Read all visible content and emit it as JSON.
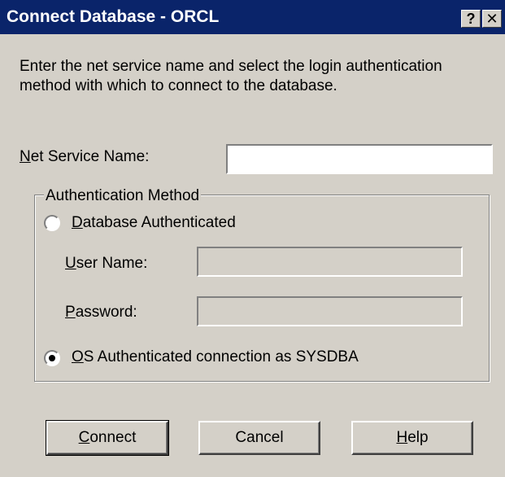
{
  "window": {
    "title": "Connect Database - ORCL",
    "help_button": "?",
    "close_button": "✕"
  },
  "intro_text": "Enter the net service name and select the login authentication method with which to connect to the database.",
  "net_service": {
    "label_mnemonic": "N",
    "label_rest": "et Service Name:",
    "value": ""
  },
  "auth": {
    "group_label": "Authentication Method",
    "database_option": {
      "mnemonic": "D",
      "rest": "atabase Authenticated",
      "selected": false
    },
    "user_name": {
      "mnemonic": "U",
      "rest": "ser Name:",
      "value": ""
    },
    "password": {
      "mnemonic": "P",
      "rest": "assword:",
      "value": ""
    },
    "os_option": {
      "mnemonic": "O",
      "rest": "S Authenticated connection as SYSDBA",
      "selected": true
    }
  },
  "buttons": {
    "connect_mnemonic": "C",
    "connect_rest": "onnect",
    "cancel": "Cancel",
    "help_mnemonic": "H",
    "help_rest": "elp"
  }
}
